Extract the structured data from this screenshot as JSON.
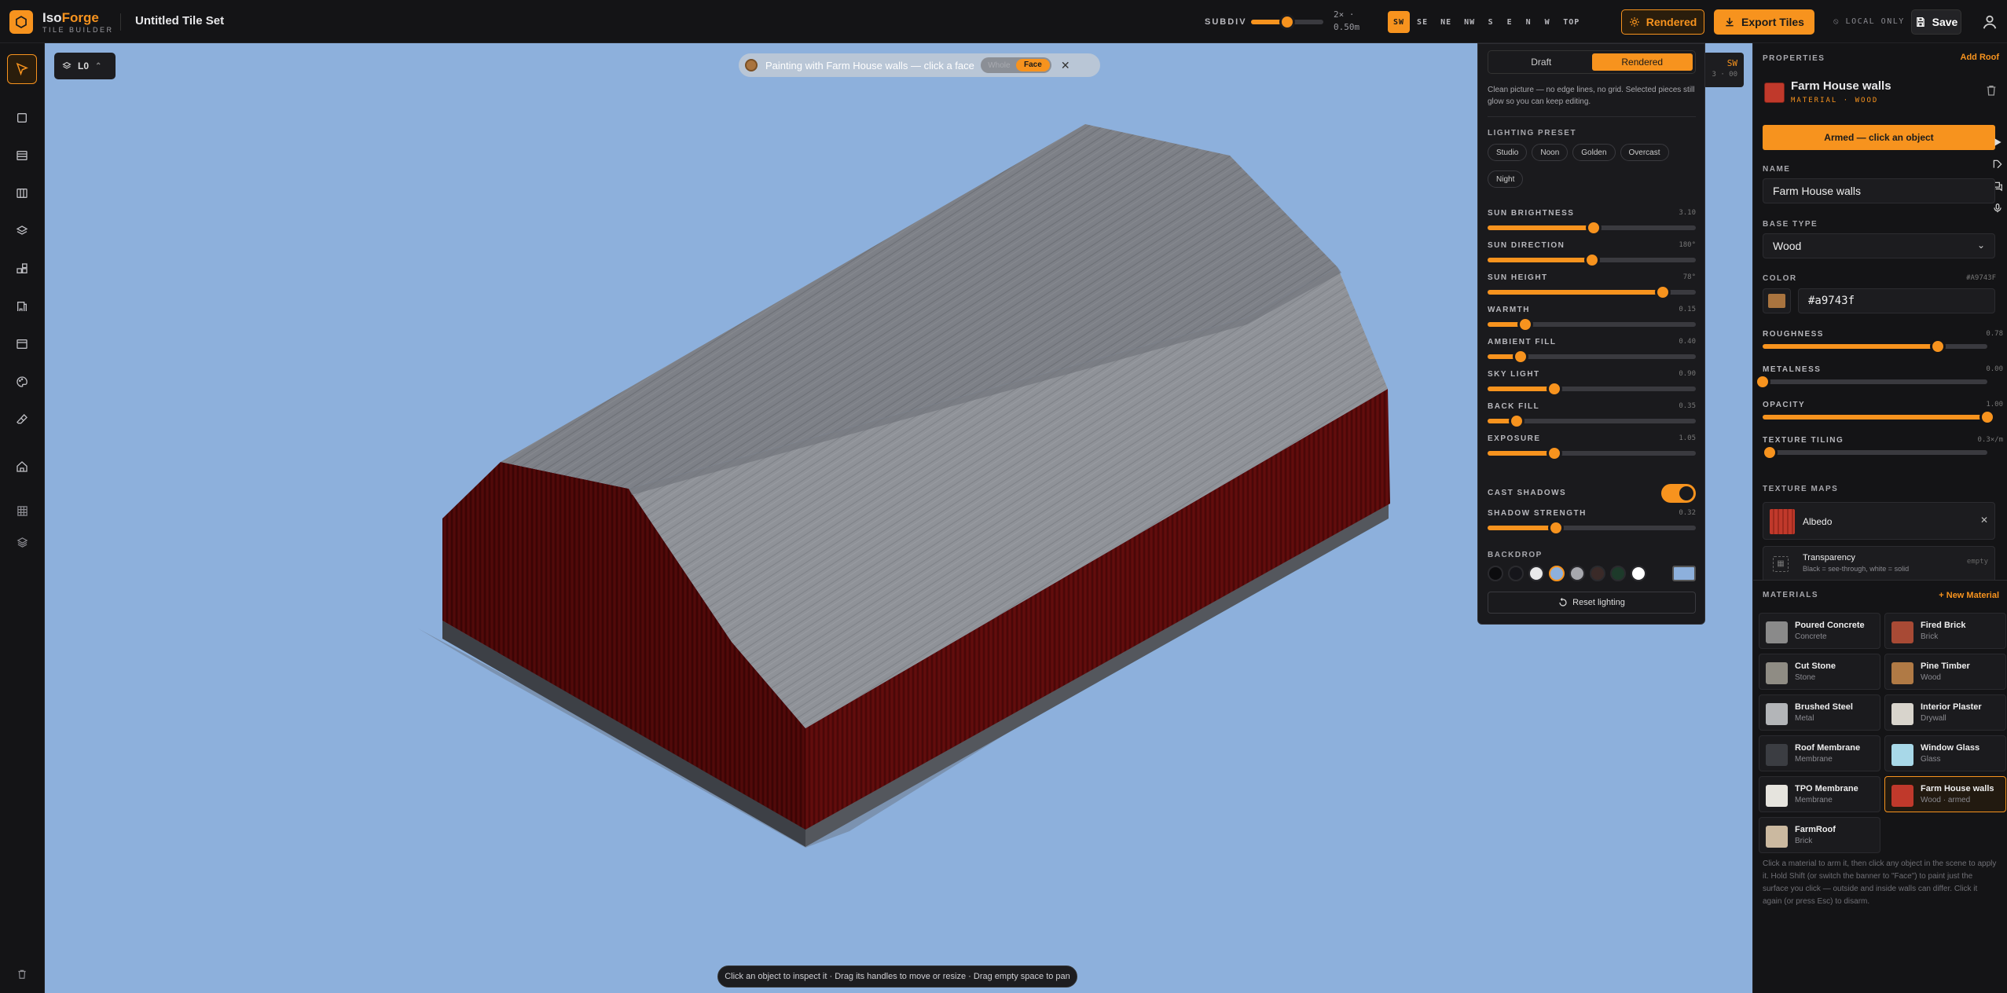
{
  "app": {
    "brand_part1": "Iso",
    "brand_part2": "Forge",
    "brand_sub": "TILE BUILDER",
    "doc_title": "Untitled Tile Set"
  },
  "toolbar": {
    "subdiv_label": "SUBDIV",
    "subdiv_value": 0.5,
    "subdiv_readout_1": "2× ·",
    "subdiv_readout_2": "0.50m",
    "views": [
      "SW",
      "SE",
      "NE",
      "NW",
      "S",
      "E",
      "N",
      "W",
      "TOP"
    ],
    "active_view": "SW",
    "rendered_label": "Rendered",
    "export_label": "Export Tiles",
    "local_only_label": "LOCAL ONLY",
    "save_label": "Save"
  },
  "left_tools": [
    "select-tool",
    "box-tool",
    "wall-tool",
    "floor-tool",
    "layers-tool",
    "components-tool",
    "stairs-tool",
    "window-tool",
    "paint-tool",
    "erase-tool",
    "home-tool",
    "grid-tool",
    "stack-tool",
    "trash-tool"
  ],
  "viewport": {
    "level_label": "L0",
    "banner_text": "Painting with Farm House walls — click a face",
    "banner_opt1": "Whole",
    "banner_opt2": "Face",
    "compass_dir": "SW",
    "compass_sub": "3 · 00",
    "hint": "Click an object to inspect it · Drag its handles to move or resize · Drag empty space to pan",
    "sky_color": "#8db0dc",
    "roof_color": "#7b7e84",
    "wall_color": "#6b0e0e"
  },
  "lighting": {
    "tabs": [
      "Draft",
      "Rendered"
    ],
    "active_tab": "Rendered",
    "desc": "Clean picture — no edge lines, no grid. Selected pieces still glow so you can keep editing.",
    "preset_label": "LIGHTING PRESET",
    "presets": [
      "Studio",
      "Noon",
      "Golden",
      "Overcast",
      "Night"
    ],
    "sliders": [
      {
        "label": "SUN BRIGHTNESS",
        "value": "3.10",
        "frac": 0.51
      },
      {
        "label": "SUN DIRECTION",
        "value": "180°",
        "frac": 0.5
      },
      {
        "label": "SUN HEIGHT",
        "value": "78°",
        "frac": 0.84
      },
      {
        "label": "WARMTH",
        "value": "0.15",
        "frac": 0.18
      },
      {
        "label": "AMBIENT FILL",
        "value": "0.40",
        "frac": 0.16
      },
      {
        "label": "SKY LIGHT",
        "value": "0.90",
        "frac": 0.32
      },
      {
        "label": "BACK FILL",
        "value": "0.35",
        "frac": 0.14
      },
      {
        "label": "EXPOSURE",
        "value": "1.05",
        "frac": 0.32
      }
    ],
    "cast_shadows_label": "CAST SHADOWS",
    "cast_shadows": true,
    "shadow_strength": {
      "label": "SHADOW STRENGTH",
      "value": "0.32",
      "frac": 0.33
    },
    "backdrop_label": "BACKDROP",
    "backdrop_swatches": [
      "#0c0c0e",
      "#15151a",
      "#e9e9ea",
      "#8db0dc",
      "#a7a8ae",
      "#3a2a28",
      "#1d3a2a",
      "#ffffff"
    ],
    "backdrop_active": 3,
    "backdrop_custom": "#8db0dc",
    "reset_label": "Reset lighting"
  },
  "properties": {
    "section_label": "PROPERTIES",
    "add_roof_label": "Add Roof",
    "object_name": "Farm House walls",
    "object_sub": "MATERIAL · WOOD",
    "armed_label": "Armed — click an object",
    "name_label": "NAME",
    "name_value": "Farm House walls",
    "base_type_label": "BASE TYPE",
    "base_type_value": "Wood",
    "color_label": "COLOR",
    "color_hex_label": "#A9743F",
    "color_value": "#a9743f",
    "sliders": [
      {
        "label": "ROUGHNESS",
        "value": "0.78",
        "frac": 0.78
      },
      {
        "label": "METALNESS",
        "value": "0.00",
        "frac": 0.0
      },
      {
        "label": "OPACITY",
        "value": "1.00",
        "frac": 1.0
      },
      {
        "label": "TEXTURE TILING",
        "value": "0.3×/m",
        "frac": 0.03
      }
    ],
    "texture_maps_label": "TEXTURE MAPS",
    "maps": [
      {
        "name": "Albedo",
        "sub": "",
        "status": ""
      },
      {
        "name": "Transparency",
        "sub": "Black = see-through, white = solid",
        "status": "empty"
      }
    ]
  },
  "materials": {
    "section_label": "MATERIALS",
    "new_label": "New Material",
    "items": [
      {
        "name": "Poured Concrete",
        "type": "Concrete",
        "color": "#8a8a8a"
      },
      {
        "name": "Fired Brick",
        "type": "Brick",
        "color": "#a84a35"
      },
      {
        "name": "Cut Stone",
        "type": "Stone",
        "color": "#8f8c84"
      },
      {
        "name": "Pine Timber",
        "type": "Wood",
        "color": "#b07a45"
      },
      {
        "name": "Brushed Steel",
        "type": "Metal",
        "color": "#b3b5b8"
      },
      {
        "name": "Interior Plaster",
        "type": "Drywall",
        "color": "#d8d4cc"
      },
      {
        "name": "Roof Membrane",
        "type": "Membrane",
        "color": "#3b3d42"
      },
      {
        "name": "Window Glass",
        "type": "Glass",
        "color": "#a8d8e8"
      },
      {
        "name": "TPO Membrane",
        "type": "Membrane",
        "color": "#e6e4de"
      },
      {
        "name": "Farm House walls",
        "type": "Wood · armed",
        "color": "#c0392b"
      },
      {
        "name": "FarmRoof",
        "type": "Brick",
        "color": "#cbb9a0"
      }
    ],
    "active_index": 9,
    "help": "Click a material to arm it, then click any object in the scene to apply it. Hold Shift (or switch the banner to \"Face\") to paint just the surface you click — outside and inside walls can differ. Click it again (or press Esc) to disarm."
  }
}
